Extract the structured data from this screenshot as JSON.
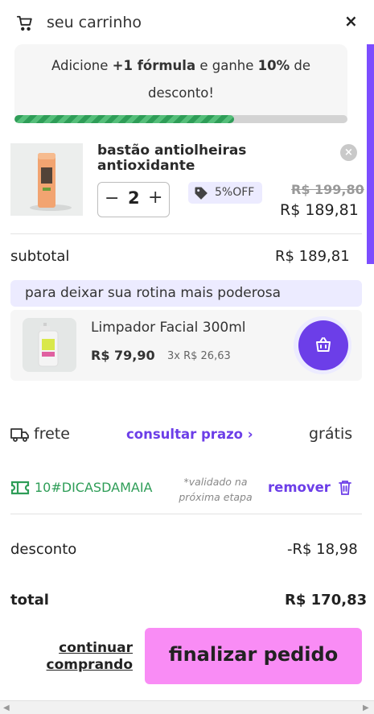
{
  "header": {
    "title": "seu carrinho",
    "close_label": "×"
  },
  "promo": {
    "text_prefix": "Adicione ",
    "text_bold1": "+1 fórmula",
    "text_mid": " e ganhe ",
    "text_bold2": "10%",
    "text_suffix": " de desconto!",
    "progress_fraction": 0.66
  },
  "cart_item": {
    "name": "bastão antiolheiras antioxidante",
    "quantity": "2",
    "qty_minus": "−",
    "qty_plus": "+",
    "discount_badge": "5%OFF",
    "old_price": "R$ 199,80",
    "new_price": "R$ 189,81",
    "remove_label": "×"
  },
  "subtotal": {
    "label": "subtotal",
    "value": "R$ 189,81"
  },
  "upsell": {
    "header": "para deixar sua rotina mais poderosa",
    "product_name": "Limpador Facial 300ml",
    "price": "R$ 79,90",
    "installments": "3x R$ 26,63"
  },
  "shipping": {
    "label": "frete",
    "link": "consultar prazo ›",
    "value": "grátis"
  },
  "coupon": {
    "code": "10#DICASDAMAIA",
    "note": "*validado na próxima etapa",
    "remove_label": "remover"
  },
  "discount": {
    "label": "desconto",
    "value": "-R$ 18,98"
  },
  "total": {
    "label": "total",
    "value": "R$ 170,83"
  },
  "footer": {
    "continue_label": "continuar comprando",
    "checkout_label": "finalizar pedido"
  },
  "colors": {
    "accent_purple": "#6c3ee8",
    "checkout_pink": "#f98cf5",
    "progress_green": "#2e9d57",
    "coupon_green": "#2e9d57"
  }
}
